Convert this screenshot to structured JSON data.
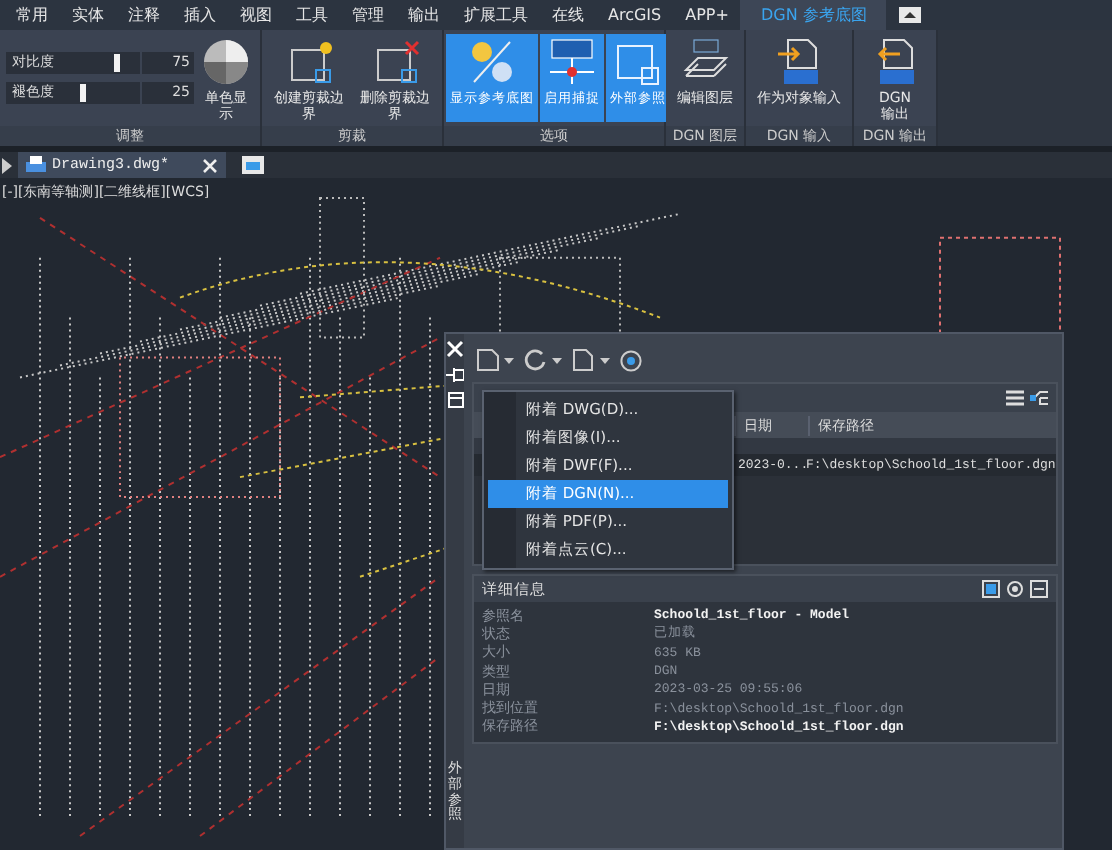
{
  "tabs": [
    {
      "label": "常用",
      "selected": false
    },
    {
      "label": "实体",
      "selected": false
    },
    {
      "label": "注释",
      "selected": false
    },
    {
      "label": "插入",
      "selected": false
    },
    {
      "label": "视图",
      "selected": false
    },
    {
      "label": "工具",
      "selected": false
    },
    {
      "label": "管理",
      "selected": false
    },
    {
      "label": "输出",
      "selected": false
    },
    {
      "label": "扩展工具",
      "selected": false
    },
    {
      "label": "在线",
      "selected": false
    },
    {
      "label": "ArcGIS",
      "selected": false
    },
    {
      "label": "APP+",
      "selected": false
    },
    {
      "label": "DGN 参考底图",
      "selected": true
    }
  ],
  "ribbon": [
    {
      "label": "调整",
      "items": [
        {
          "kind": "slider",
          "label": "对比度",
          "value": "75",
          "level": 0.75
        },
        {
          "kind": "slider",
          "label": "褪色度",
          "value": "25",
          "level": 0.25
        },
        {
          "kind": "button",
          "label": "单色显示"
        }
      ]
    },
    {
      "label": "剪裁",
      "items": [
        {
          "kind": "button",
          "label": "创建剪裁边界"
        },
        {
          "kind": "button",
          "label": "删除剪裁边界"
        }
      ]
    },
    {
      "label": "选项",
      "items": [
        {
          "kind": "toggle",
          "label": "显示参考底图",
          "on": true
        },
        {
          "kind": "toggle",
          "label": "启用捕捉",
          "on": true
        },
        {
          "kind": "toggle",
          "label": "外部参照",
          "on": true
        }
      ]
    },
    {
      "label": "DGN 图层",
      "items": [
        {
          "kind": "button",
          "label": "编辑图层"
        }
      ]
    },
    {
      "label": "DGN 输入",
      "items": [
        {
          "kind": "button",
          "label": "作为对象输入"
        }
      ]
    },
    {
      "label": "DGN 输出",
      "items": [
        {
          "kind": "button",
          "label": "DGN\n输出"
        }
      ]
    }
  ],
  "file_tab": {
    "title": "Drawing3.dwg*"
  },
  "viewport_label": "[-][东南等轴测][二维线框][WCS]",
  "palette": {
    "title": "外部参照",
    "menu": [
      {
        "label": "附着 DWG(D)...",
        "selected": false
      },
      {
        "label": "附着图像(I)...",
        "selected": false
      },
      {
        "label": "附着 DWF(F)...",
        "selected": false
      },
      {
        "label": "附着 DGN(N)...",
        "selected": true
      },
      {
        "label": "附着 PDF(P)...",
        "selected": false
      },
      {
        "label": "附着点云(C)...",
        "selected": false
      }
    ],
    "columns": [
      "日期",
      "保存路径"
    ],
    "rows": [
      {
        "date": "2023-0...",
        "path": "F:\\desktop\\Schoold_1st_floor.dgn"
      }
    ],
    "details": {
      "title": "详细信息",
      "rows": [
        {
          "label": "参照名",
          "value": "Schoold_1st_floor - Model",
          "emphasis": true
        },
        {
          "label": "状态",
          "value": "已加载",
          "emphasis": false
        },
        {
          "label": "大小",
          "value": "635 KB",
          "emphasis": false
        },
        {
          "label": "类型",
          "value": "DGN",
          "emphasis": false
        },
        {
          "label": "日期",
          "value": "2023-03-25 09:55:06",
          "emphasis": false
        },
        {
          "label": "找到位置",
          "value": "F:\\desktop\\Schoold_1st_floor.dgn",
          "emphasis": false
        },
        {
          "label": "保存路径",
          "value": "F:\\desktop\\Schoold_1st_floor.dgn",
          "emphasis": true
        }
      ]
    }
  }
}
